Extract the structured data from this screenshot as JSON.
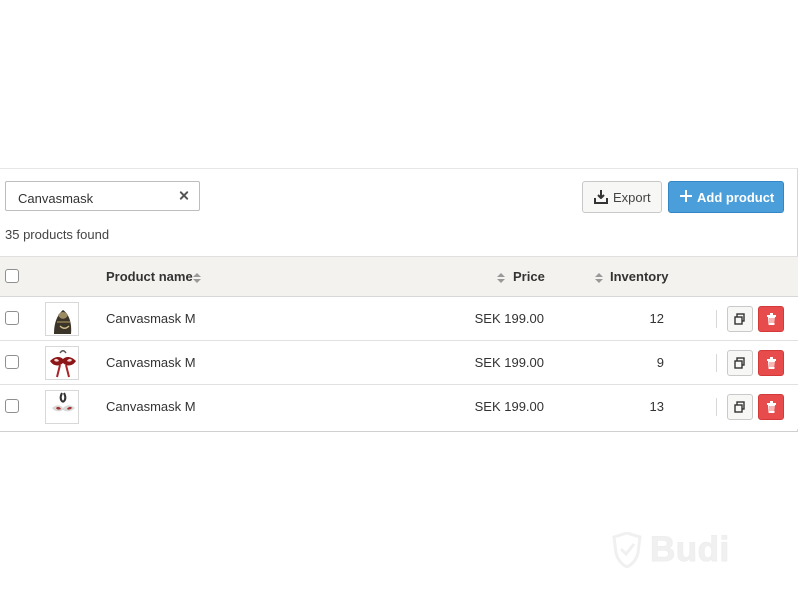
{
  "search": {
    "value": "Canvasmask",
    "placeholder": ""
  },
  "toolbar": {
    "export_label": "Export",
    "add_product_label": "Add product"
  },
  "results": {
    "count_text": "35 products found"
  },
  "table": {
    "headers": {
      "product_name": "Product name",
      "price": "Price",
      "inventory": "Inventory"
    },
    "rows": [
      {
        "product_name": "Canvasmask M",
        "price": "SEK 199.00",
        "inventory": "12"
      },
      {
        "product_name": "Canvasmask M",
        "price": "SEK 199.00",
        "inventory": "9"
      },
      {
        "product_name": "Canvasmask M",
        "price": "SEK 199.00",
        "inventory": "13"
      }
    ]
  },
  "watermark": {
    "text": "Budi"
  },
  "icons": {
    "clear": "close-icon",
    "export": "export-icon",
    "add": "plus-icon",
    "sort": "sort-icon",
    "copy": "copy-icon",
    "delete": "trash-icon"
  },
  "colors": {
    "primary": "#4a9fdb",
    "danger": "#e84b4b",
    "header_background": "#f4f2ee",
    "border": "#d7d7d7"
  }
}
